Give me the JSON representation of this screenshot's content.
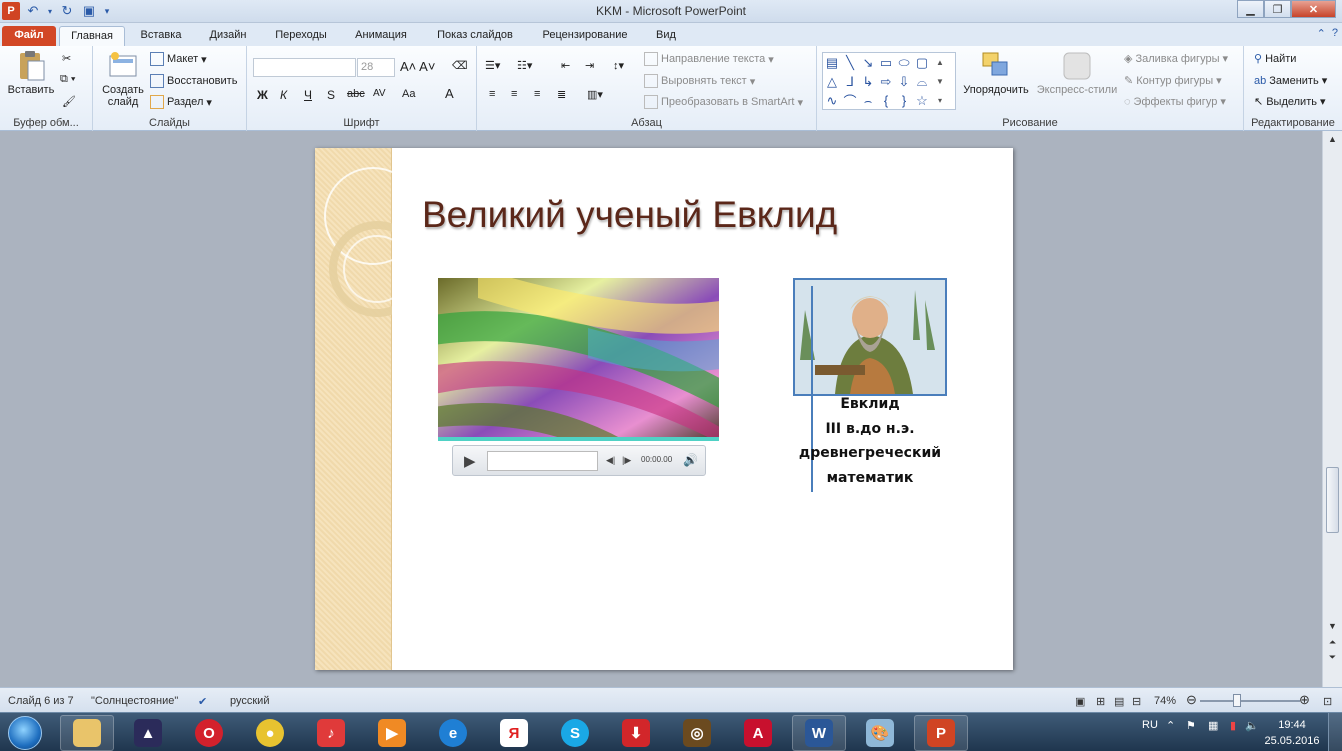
{
  "window": {
    "title": "KKM  -  Microsoft PowerPoint",
    "minimize_icon": "minimize-icon",
    "maximize_icon": "restore-icon",
    "close_icon": "close-icon"
  },
  "tabs": [
    {
      "label": "Файл"
    },
    {
      "label": "Главная"
    },
    {
      "label": "Вставка"
    },
    {
      "label": "Дизайн"
    },
    {
      "label": "Переходы"
    },
    {
      "label": "Анимация"
    },
    {
      "label": "Показ слайдов"
    },
    {
      "label": "Рецензирование"
    },
    {
      "label": "Вид"
    }
  ],
  "ribbon": {
    "clipboard": {
      "label": "Буфер обм...",
      "paste": "Вставить"
    },
    "slides": {
      "label": "Слайды",
      "new_slide": "Создать слайд",
      "layout": "Макет",
      "reset": "Восстановить",
      "section": "Раздел"
    },
    "font": {
      "label": "Шрифт",
      "font_size": "28",
      "bold": "Ж",
      "italic": "К",
      "underline": "Ч",
      "strike": "abc",
      "shadow": "S",
      "spacing": "AV",
      "case": "Aa",
      "color": "A"
    },
    "paragraph": {
      "label": "Абзац",
      "text_direction": "Направление текста",
      "align_text": "Выровнять текст",
      "smartart": "Преобразовать в SmartArt"
    },
    "drawing": {
      "label": "Рисование",
      "arrange": "Упорядочить",
      "quick_styles": "Экспресс-стили",
      "shape_fill": "Заливка фигуры",
      "shape_outline": "Контур фигуры",
      "shape_effects": "Эффекты фигур"
    },
    "editing": {
      "label": "Редактирование",
      "find": "Найти",
      "replace": "Заменить",
      "select": "Выделить"
    }
  },
  "slide": {
    "title": "Великий ученый Евклид",
    "caption_lines": [
      "Евклид",
      "III в.до н.э.",
      "древнегреческий",
      "математик"
    ],
    "player_time": "00:00.00"
  },
  "status": {
    "slide_info": "Слайд 6 из 7",
    "theme": "\"Солнцестояние\"",
    "language": "русский",
    "zoom": "74%"
  },
  "taskbar": {
    "lang": "RU",
    "time": "19:44",
    "date": "25.05.2016"
  },
  "colors": {
    "title_color": "#5b2719",
    "file_tab": "#d24726",
    "accent_blue": "#4a7ebb"
  }
}
